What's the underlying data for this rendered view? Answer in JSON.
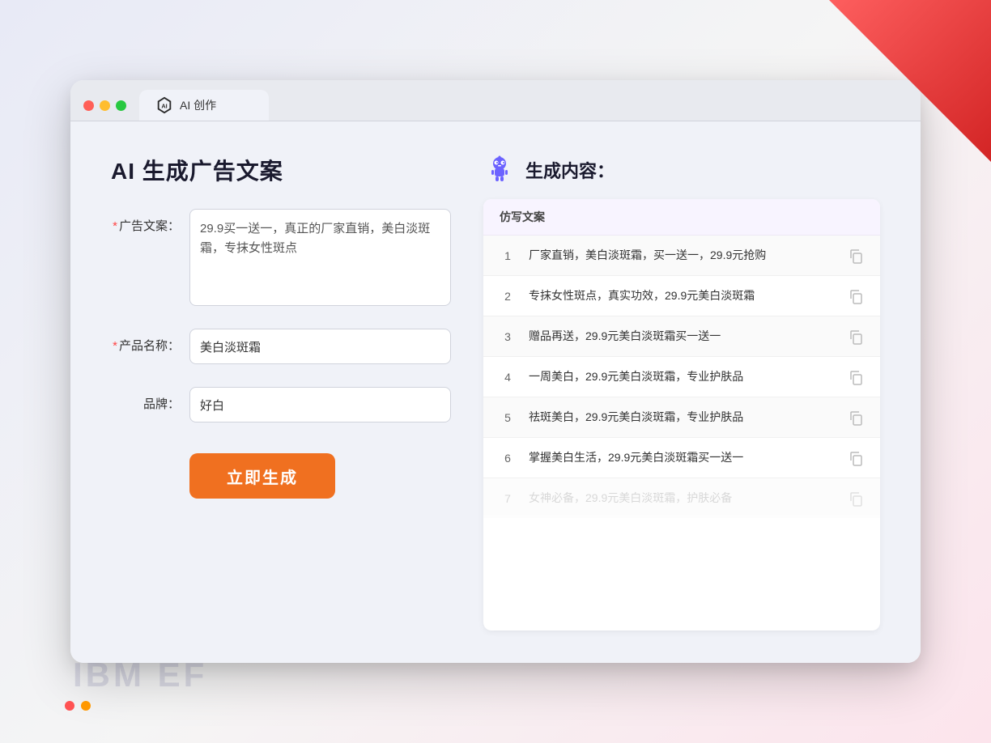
{
  "background": {
    "ibm_text": "IBM EF"
  },
  "browser": {
    "tab_title": "AI 创作",
    "traffic_lights": [
      "red",
      "yellow",
      "green"
    ]
  },
  "left_panel": {
    "title": "AI 生成广告文案",
    "fields": [
      {
        "label": "广告文案：",
        "required": true,
        "type": "textarea",
        "value": "29.9买一送一，真正的厂家直销，美白淡斑霜，专抹女性斑点"
      },
      {
        "label": "产品名称：",
        "required": true,
        "type": "input",
        "value": "美白淡斑霜"
      },
      {
        "label": "品牌：",
        "required": false,
        "type": "input",
        "value": "好白"
      }
    ],
    "generate_button": "立即生成"
  },
  "right_panel": {
    "title": "生成内容：",
    "table_header": "仿写文案",
    "results": [
      {
        "num": "1",
        "text": "厂家直销，美白淡斑霜，买一送一，29.9元抢购"
      },
      {
        "num": "2",
        "text": "专抹女性斑点，真实功效，29.9元美白淡斑霜"
      },
      {
        "num": "3",
        "text": "赠品再送，29.9元美白淡斑霜买一送一"
      },
      {
        "num": "4",
        "text": "一周美白，29.9元美白淡斑霜，专业护肤品"
      },
      {
        "num": "5",
        "text": "祛斑美白，29.9元美白淡斑霜，专业护肤品"
      },
      {
        "num": "6",
        "text": "掌握美白生活，29.9元美白淡斑霜买一送一"
      },
      {
        "num": "7",
        "text": "女神必备，29.9元美白淡斑霜，护肤必备",
        "faded": true
      }
    ]
  }
}
